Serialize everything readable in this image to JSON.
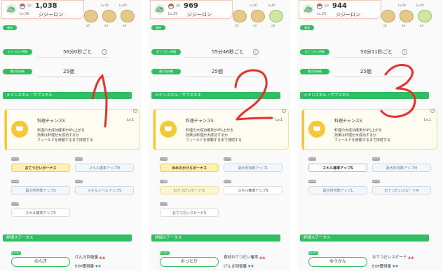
{
  "panels": [
    {
      "sp_label": "SP",
      "sp_value": "1,038",
      "level": "Lv.39",
      "name": "ジジーロン",
      "ingredient_levels": [
        "Lv.30",
        "Lv.60"
      ],
      "ingredient_counts": [
        "x5",
        "x3",
        "x4"
      ],
      "food_tag": "食材",
      "help_interval_label": "おてつだい時間",
      "help_interval_value": "56分0秒ごと",
      "max_carry_label": "最大所持数",
      "max_carry_value": "25個",
      "skill_section_title": "メインスキル・サブスキル",
      "skill_name": "料理チャンスS",
      "skill_level": "Lv.1",
      "skill_desc": [
        "料理の大成功確率が4%上がる",
        "効果は料理が大成功するか",
        "フィールドを移動するまで持続する"
      ],
      "subskills": [
        {
          "lv": "Lv.10",
          "label": "おてつだいボーナス",
          "style": "gold"
        },
        {
          "lv": "Lv.25",
          "label": "スキル確率アップM",
          "style": "pale-blue"
        },
        {
          "lv": "Lv.50",
          "label": "最大所持数アップS",
          "style": "pale-blue"
        },
        {
          "lv": "Lv.75",
          "label": "スキルレベルアップS",
          "style": "pale-blue"
        },
        {
          "lv": "Lv.100",
          "label": "スキル確率アップS",
          "style": "white"
        }
      ],
      "detail_section_title": "詳細ステータス",
      "nature_badge": "せいかく",
      "nature": "のんき",
      "effects": [
        {
          "label": "げんき回復量",
          "arrow": "up"
        },
        {
          "label": "EXP獲得量",
          "arrow": "down"
        }
      ]
    },
    {
      "sp_label": "SP",
      "sp_value": "969",
      "level": "Lv.25",
      "name": "ジジーロン",
      "ingredient_levels": [
        "Lv.30",
        "Lv.60"
      ],
      "ingredient_counts": [
        "x5",
        "x3",
        "x4"
      ],
      "food_tag": "食材",
      "help_interval_label": "おてつだい時間",
      "help_interval_value": "55分46秒ごと",
      "max_carry_label": "最大所持数",
      "max_carry_value": "25個",
      "skill_section_title": "メインスキル・サブスキル",
      "skill_name": "料理チャンスS",
      "skill_level": "Lv.1",
      "skill_desc": [
        "料理の大成功確率が4%上がる",
        "効果は料理が大成功するか",
        "フィールドを移動するまで持続する"
      ],
      "subskills": [
        {
          "lv": "Lv.10",
          "label": "ゆめのかけらボーナス",
          "style": "gold"
        },
        {
          "lv": "Lv.25",
          "label": "最大所持数アップL",
          "style": "pale-blue"
        },
        {
          "lv": "Lv.50",
          "label": "おてつだいボーナス",
          "style": "pale-gold"
        },
        {
          "lv": "Lv.75",
          "label": "スキル確率アップS",
          "style": "white"
        },
        {
          "lv": "Lv.100",
          "label": "おてつだいスピードS",
          "style": "white"
        }
      ],
      "detail_section_title": "詳細ステータス",
      "nature_badge": "せいかく",
      "nature": "おっとり",
      "effects": [
        {
          "label": "食材おてつだい確率",
          "arrow": "up"
        },
        {
          "label": "げんき回復量",
          "arrow": "down"
        }
      ]
    },
    {
      "sp_label": "SP",
      "sp_value": "944",
      "level": "Lv.25",
      "name": "ジジーロン",
      "ingredient_levels": [
        "Lv.30",
        "Lv.60"
      ],
      "ingredient_counts": [
        "x5",
        "x3",
        "x4"
      ],
      "food_tag": "食材",
      "help_interval_label": "おてつだい時間",
      "help_interval_value": "50分11秒ごと",
      "max_carry_label": "最大所持数",
      "max_carry_value": "25個",
      "skill_section_title": "メインスキル・サブスキル",
      "skill_name": "料理チャンスS",
      "skill_level": "Lv.1",
      "skill_desc": [
        "料理の大成功確率が4%上がる",
        "効果は料理が大成功するか",
        "フィールドを移動するまで持続する"
      ],
      "subskills": [
        {
          "lv": "Lv.10",
          "label": "スキル確率アップS",
          "style": "white-red"
        },
        {
          "lv": "Lv.25",
          "label": "最大所持数アップM",
          "style": "pale-blue"
        },
        {
          "lv": "Lv.50",
          "label": "最大所持数アップL",
          "style": "pale-blue"
        },
        {
          "lv": "Lv.75",
          "label": "おてつだいスピードM",
          "style": "pale-blue"
        },
        {
          "lv": "Lv.100",
          "label": "",
          "style": "none"
        }
      ],
      "detail_section_title": "詳細ステータス",
      "nature_badge": "せいかく",
      "nature": "ゆうかん",
      "effects": [
        {
          "label": "おてつだいスピード",
          "arrow": "up"
        },
        {
          "label": "EXP獲得量",
          "arrow": "down"
        }
      ]
    }
  ],
  "annotations": [
    "1",
    "2",
    "3"
  ],
  "colors": {
    "accent_green": "#2fbf62",
    "skill_yellow": "#f5c935",
    "annotation_red": "#e8302a",
    "arrow_up": "#e8543e",
    "arrow_down": "#3d8ee5"
  },
  "icons": {
    "pokemon": "dragon-pokemon-icon",
    "ball": "pokeball-icon",
    "ingredient": "ingredient-icon",
    "info": "info-icon",
    "skill": "cooking-pot-icon"
  },
  "info_glyph": "i",
  "arrow_up_glyph": "▲▲",
  "arrow_down_glyph": "▼▼"
}
